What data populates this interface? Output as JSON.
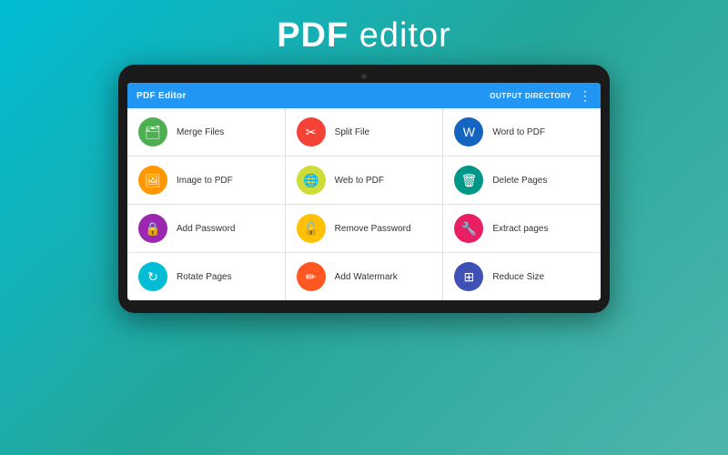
{
  "title": {
    "pdf": "PDF",
    "editor": " editor"
  },
  "app": {
    "title": "PDF Editor",
    "output_directory": "OUTPUT DIRECTORY",
    "menu_dots": "⋮"
  },
  "features": [
    {
      "id": "merge-files",
      "label": "Merge Files",
      "icon": "🗂",
      "color_class": "green"
    },
    {
      "id": "split-file",
      "label": "Split File",
      "icon": "✂",
      "color_class": "red"
    },
    {
      "id": "word-to-pdf",
      "label": "Word to PDF",
      "icon": "W",
      "color_class": "blue-dark"
    },
    {
      "id": "image-to-pdf",
      "label": "Image to PDF",
      "icon": "🖼",
      "color_class": "orange"
    },
    {
      "id": "web-to-pdf",
      "label": "Web to PDF",
      "icon": "🌐",
      "color_class": "yellow-green"
    },
    {
      "id": "delete-pages",
      "label": "Delete Pages",
      "icon": "🗑",
      "color_class": "teal"
    },
    {
      "id": "add-password",
      "label": "Add Password",
      "icon": "🔒",
      "color_class": "purple"
    },
    {
      "id": "remove-password",
      "label": "Remove Password",
      "icon": "🔓",
      "color_class": "amber"
    },
    {
      "id": "extract-pages",
      "label": "Extract pages",
      "icon": "🔧",
      "color_class": "pink"
    },
    {
      "id": "rotate-pages",
      "label": "Rotate Pages",
      "icon": "↻",
      "color_class": "cyan"
    },
    {
      "id": "add-watermark",
      "label": "Add Watermark",
      "icon": "✏",
      "color_class": "deep-orange"
    },
    {
      "id": "reduce-size",
      "label": "Reduce Size",
      "icon": "⊞",
      "color_class": "indigo"
    }
  ]
}
